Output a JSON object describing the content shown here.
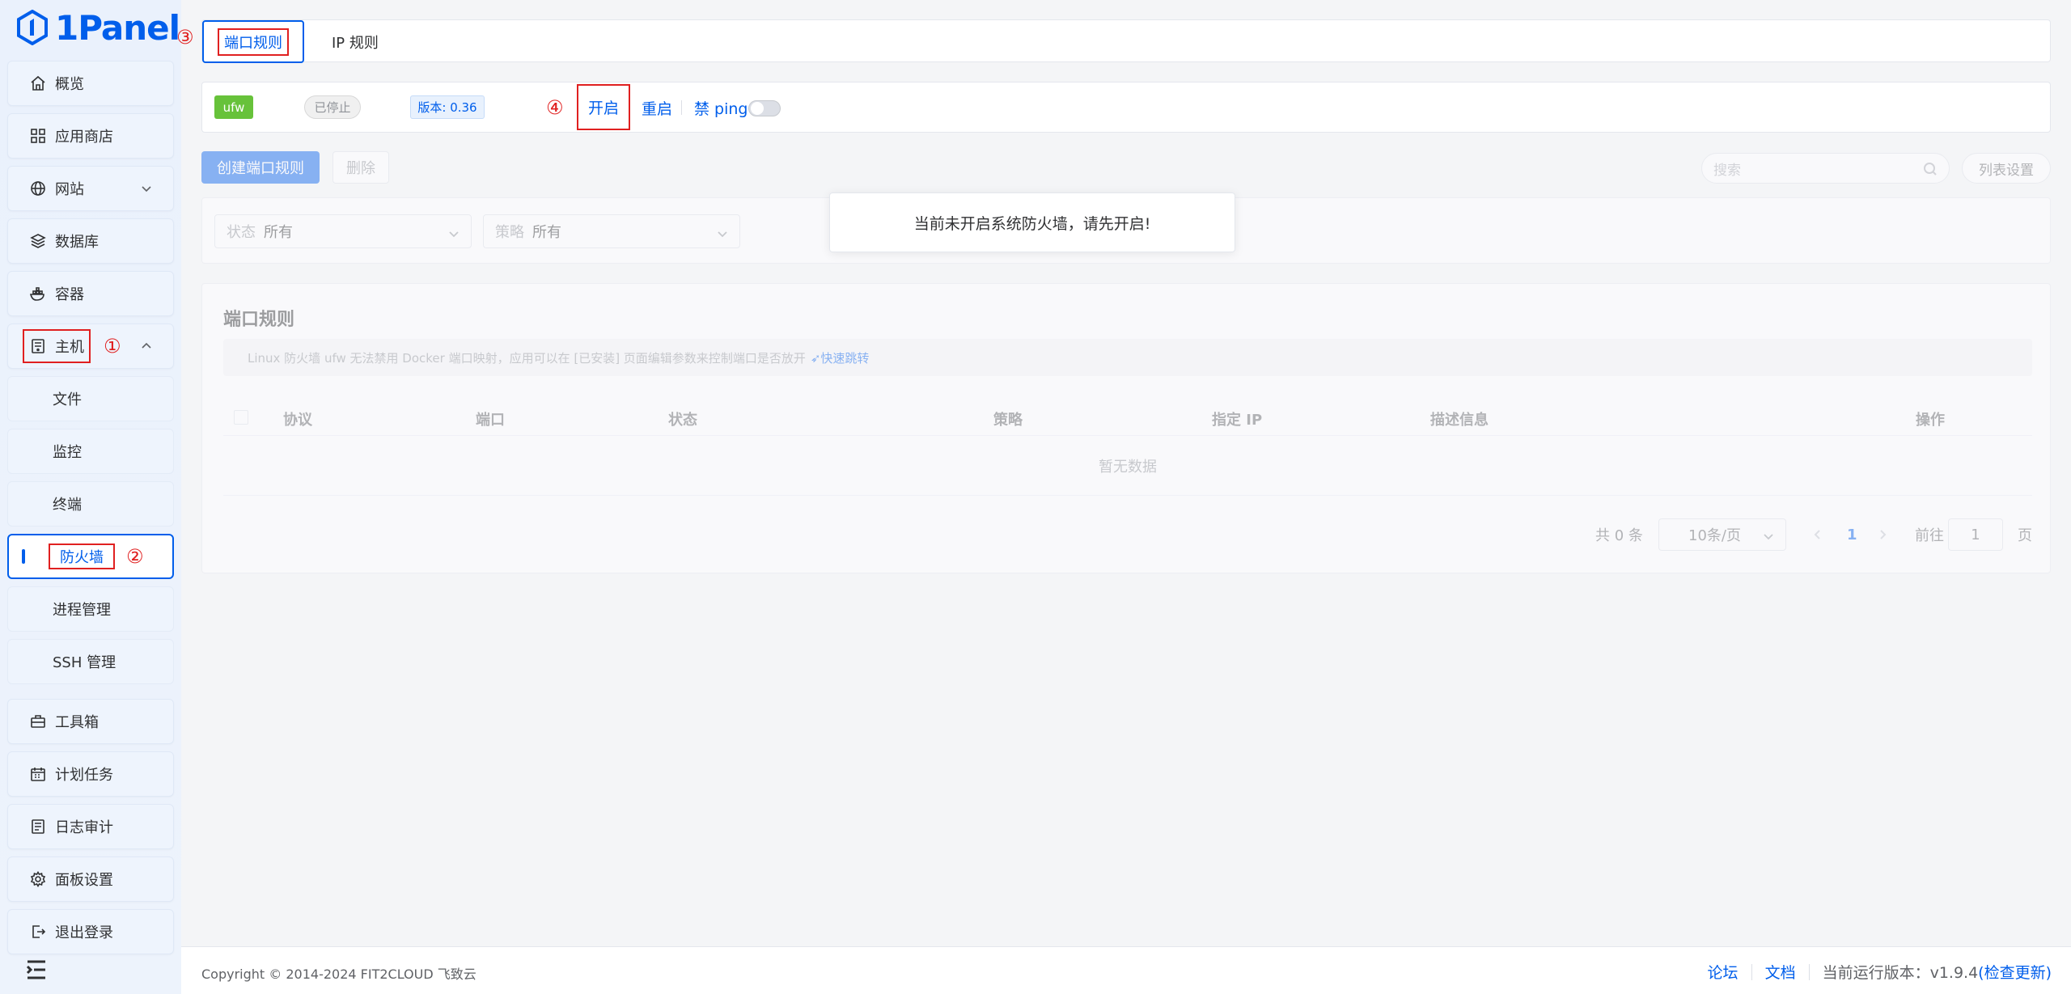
{
  "brand": {
    "logo_text": "1Panel",
    "accent": "#005eeb"
  },
  "sidebar": {
    "items": [
      {
        "label": "概览",
        "icon": "home-icon"
      },
      {
        "label": "应用商店",
        "icon": "grid-icon"
      },
      {
        "label": "网站",
        "icon": "globe-icon"
      },
      {
        "label": "数据库",
        "icon": "layers-icon"
      },
      {
        "label": "容器",
        "icon": "docker-icon"
      },
      {
        "label": "主机",
        "icon": "server-icon",
        "marker": "①"
      },
      {
        "label": "工具箱",
        "icon": "toolbox-icon"
      },
      {
        "label": "计划任务",
        "icon": "calendar-icon"
      },
      {
        "label": "日志审计",
        "icon": "log-icon"
      },
      {
        "label": "面板设置",
        "icon": "gear-icon"
      },
      {
        "label": "退出登录",
        "icon": "logout-icon"
      }
    ],
    "host_children": [
      {
        "label": "文件"
      },
      {
        "label": "监控"
      },
      {
        "label": "终端"
      },
      {
        "label": "防火墙",
        "marker": "②"
      },
      {
        "label": "进程管理"
      },
      {
        "label": "SSH 管理"
      }
    ]
  },
  "tabs": {
    "marker": "③",
    "port_rules": "端口规则",
    "ip_rules": "IP 规则"
  },
  "status": {
    "engine": "ufw",
    "state": "已停止",
    "version": "版本: 0.36",
    "marker": "④",
    "start": "开启",
    "restart": "重启",
    "ping": "禁 ping",
    "ping_enabled": false
  },
  "toolbar": {
    "create": "创建端口规则",
    "delete": "删除",
    "search_placeholder": "搜索",
    "columns": "列表设置"
  },
  "filters": {
    "status_label": "状态",
    "status_value": "所有",
    "strategy_label": "策略",
    "strategy_value": "所有"
  },
  "toast": {
    "message": "当前未开启系统防火墙，请先开启!"
  },
  "table": {
    "title": "端口规则",
    "info": "Linux 防火墙 ufw 无法禁用 Docker 端口映射，应用可以在 [已安装] 页面编辑参数来控制端口是否放开",
    "info_link": "快速跳转",
    "columns": [
      "协议",
      "端口",
      "状态",
      "策略",
      "指定 IP",
      "描述信息",
      "操作"
    ],
    "empty": "暂无数据",
    "pagination": {
      "total": "共 0 条",
      "page_size": "10条/页",
      "current_page": "1",
      "goto_label": "前往",
      "goto_value": "1",
      "page_suffix": "页"
    }
  },
  "footer": {
    "copyright": "Copyright © 2014-2024 FIT2CLOUD 飞致云",
    "forum": "论坛",
    "docs": "文档",
    "version": "当前运行版本：v1.9.4",
    "check_update": "(检查更新)"
  }
}
